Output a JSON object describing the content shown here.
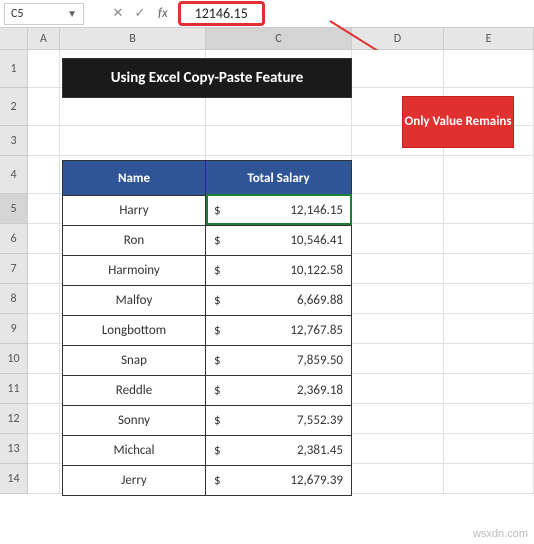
{
  "formula_bar": {
    "cell_ref": "C5",
    "value": "12146.15",
    "cancel": "✕",
    "confirm": "✓",
    "fx": "fx"
  },
  "columns": [
    "A",
    "B",
    "C",
    "D",
    "E"
  ],
  "rows": [
    "1",
    "2",
    "3",
    "4",
    "5",
    "6",
    "7",
    "8",
    "9",
    "10",
    "11",
    "12",
    "13",
    "14"
  ],
  "title": "Using Excel Copy-Paste Feature",
  "callout": "Only Value Remains",
  "table": {
    "headers": {
      "name": "Name",
      "salary": "Total Salary"
    },
    "rows": [
      {
        "name": "Harry",
        "salary": "12,146.15"
      },
      {
        "name": "Ron",
        "salary": "10,546.41"
      },
      {
        "name": "Harmoiny",
        "salary": "10,122.58"
      },
      {
        "name": "Malfoy",
        "salary": "6,669.88"
      },
      {
        "name": "Longbottom",
        "salary": "12,767.85"
      },
      {
        "name": "Snap",
        "salary": "7,859.50"
      },
      {
        "name": "Reddle",
        "salary": "2,369.18"
      },
      {
        "name": "Sonny",
        "salary": "7,552.39"
      },
      {
        "name": "Michcal",
        "salary": "2,381.45"
      },
      {
        "name": "Jerry",
        "salary": "12,679.39"
      }
    ],
    "currency": "$"
  },
  "watermark": "wsxdn.com"
}
